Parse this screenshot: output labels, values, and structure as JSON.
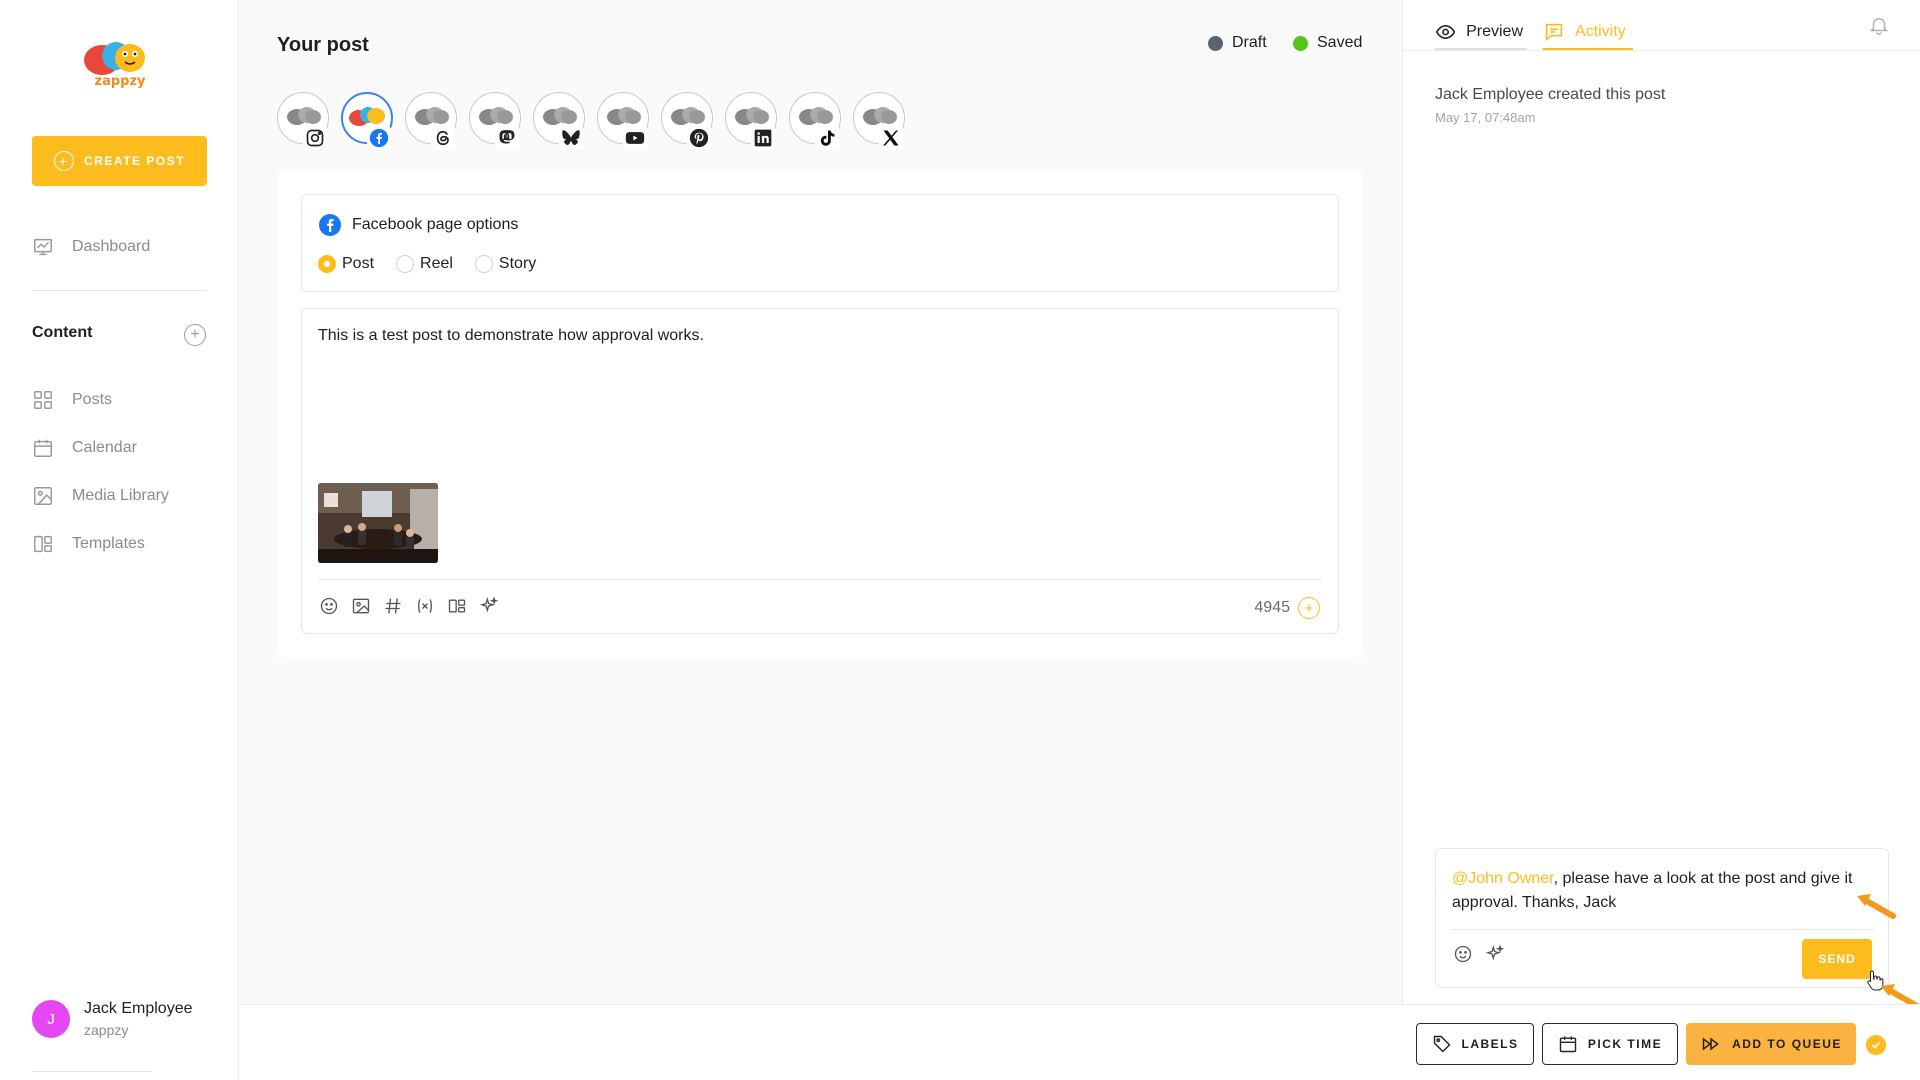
{
  "brand": {
    "name": "zappzy",
    "accent": "#fcbc1d"
  },
  "sidebar": {
    "create_label": "CREATE POST",
    "dashboard_label": "Dashboard",
    "content_title": "Content",
    "items": [
      {
        "label": "Posts",
        "icon": "grid-icon"
      },
      {
        "label": "Calendar",
        "icon": "calendar-icon"
      },
      {
        "label": "Media Library",
        "icon": "image-icon"
      },
      {
        "label": "Templates",
        "icon": "template-icon"
      }
    ],
    "user": {
      "initial": "J",
      "name": "Jack Employee",
      "org": "zappzy"
    }
  },
  "main": {
    "title": "Your post",
    "status": {
      "draft": "Draft",
      "saved": "Saved",
      "draft_color": "#5c6370",
      "saved_color": "#57c41a"
    },
    "channels": [
      "instagram",
      "facebook",
      "threads",
      "mastodon",
      "bluesky",
      "youtube",
      "pinterest",
      "linkedin",
      "tiktok",
      "x"
    ],
    "active_channel": "facebook",
    "fb_options": {
      "title": "Facebook page options",
      "types": [
        "Post",
        "Reel",
        "Story"
      ],
      "selected": "Post"
    },
    "editor": {
      "text": "This is a test post to demonstrate how approval works.",
      "char_count": "4945"
    }
  },
  "right_panel": {
    "tabs": {
      "preview": "Preview",
      "activity": "Activity"
    },
    "activity": {
      "line": "Jack Employee created this post",
      "time": "May 17, 07:48am"
    },
    "comment": {
      "mention": "@John Owner",
      "text": ", please have a look at the post and give it approval. Thanks, Jack",
      "send_label": "SEND"
    }
  },
  "footer": {
    "labels_label": "LABELS",
    "pick_time_label": "PICK TIME",
    "queue_label": "ADD TO QUEUE"
  }
}
